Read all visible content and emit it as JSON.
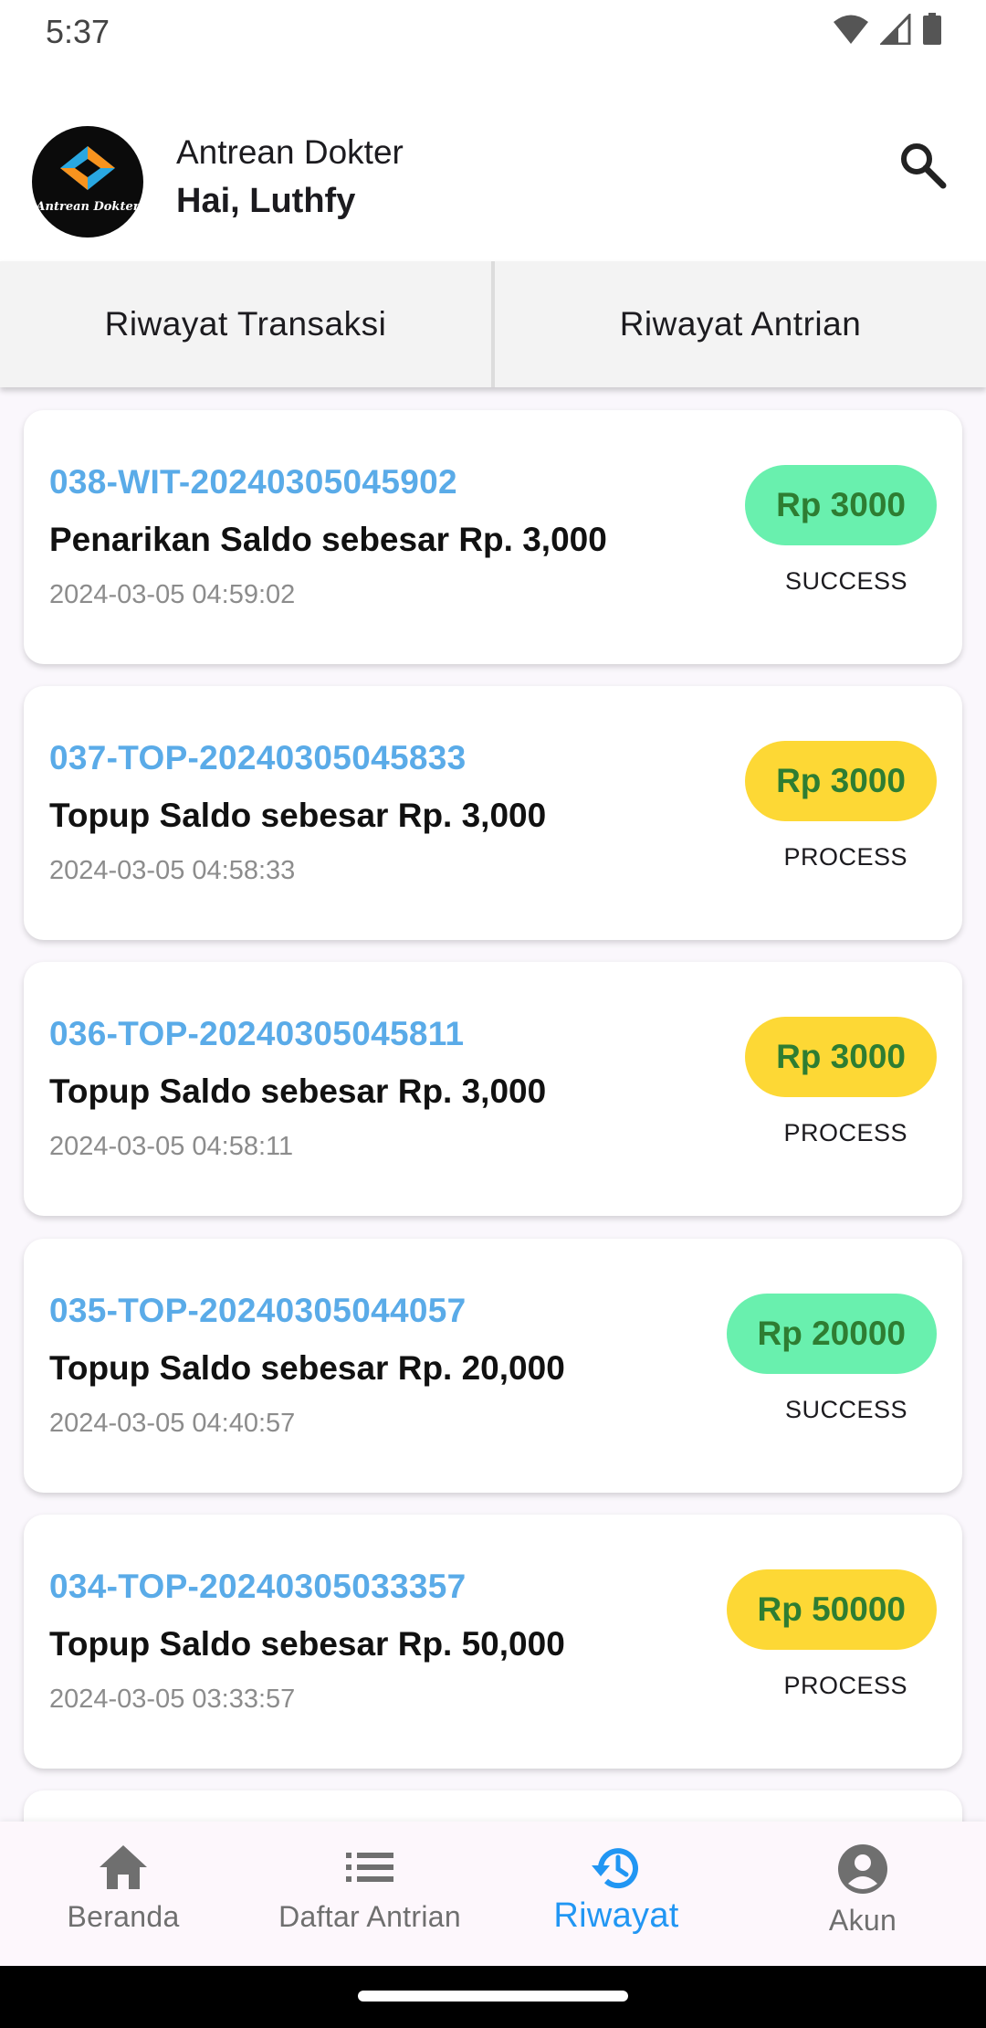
{
  "status_bar": {
    "time": "5:37",
    "icons": [
      "wifi-icon",
      "signal-icon",
      "battery-icon"
    ]
  },
  "header": {
    "logo_text": "Antrean Dokter",
    "app_name": "Antrean Dokter",
    "greeting": "Hai, Luthfy",
    "search_icon": "search-icon"
  },
  "tabs": [
    {
      "label": "Riwayat Transaksi"
    },
    {
      "label": "Riwayat Antrian"
    }
  ],
  "transactions": [
    {
      "id": "038-WIT-20240305045902",
      "description": "Penarikan Saldo sebesar Rp. 3,000",
      "date": "2024-03-05 04:59:02",
      "amount": "Rp 3000",
      "status": "SUCCESS"
    },
    {
      "id": "037-TOP-20240305045833",
      "description": "Topup Saldo sebesar Rp. 3,000",
      "date": "2024-03-05 04:58:33",
      "amount": "Rp 3000",
      "status": "PROCESS"
    },
    {
      "id": "036-TOP-20240305045811",
      "description": "Topup Saldo sebesar Rp. 3,000",
      "date": "2024-03-05 04:58:11",
      "amount": "Rp 3000",
      "status": "PROCESS"
    },
    {
      "id": "035-TOP-20240305044057",
      "description": "Topup Saldo sebesar Rp. 20,000",
      "date": "2024-03-05 04:40:57",
      "amount": "Rp 20000",
      "status": "SUCCESS"
    },
    {
      "id": "034-TOP-20240305033357",
      "description": "Topup Saldo sebesar Rp. 50,000",
      "date": "2024-03-05 03:33:57",
      "amount": "Rp 50000",
      "status": "PROCESS"
    }
  ],
  "bottom_nav": [
    {
      "label": "Beranda",
      "icon": "home-icon"
    },
    {
      "label": "Daftar Antrian",
      "icon": "list-icon"
    },
    {
      "label": "Riwayat",
      "icon": "history-icon",
      "active": true
    },
    {
      "label": "Akun",
      "icon": "account-icon"
    }
  ],
  "colors": {
    "accent": "#2196f3",
    "id_text": "#5aabe8",
    "success_pill": "#69f0ae",
    "process_pill": "#fdd835",
    "amount_text": "#2e7d32"
  }
}
